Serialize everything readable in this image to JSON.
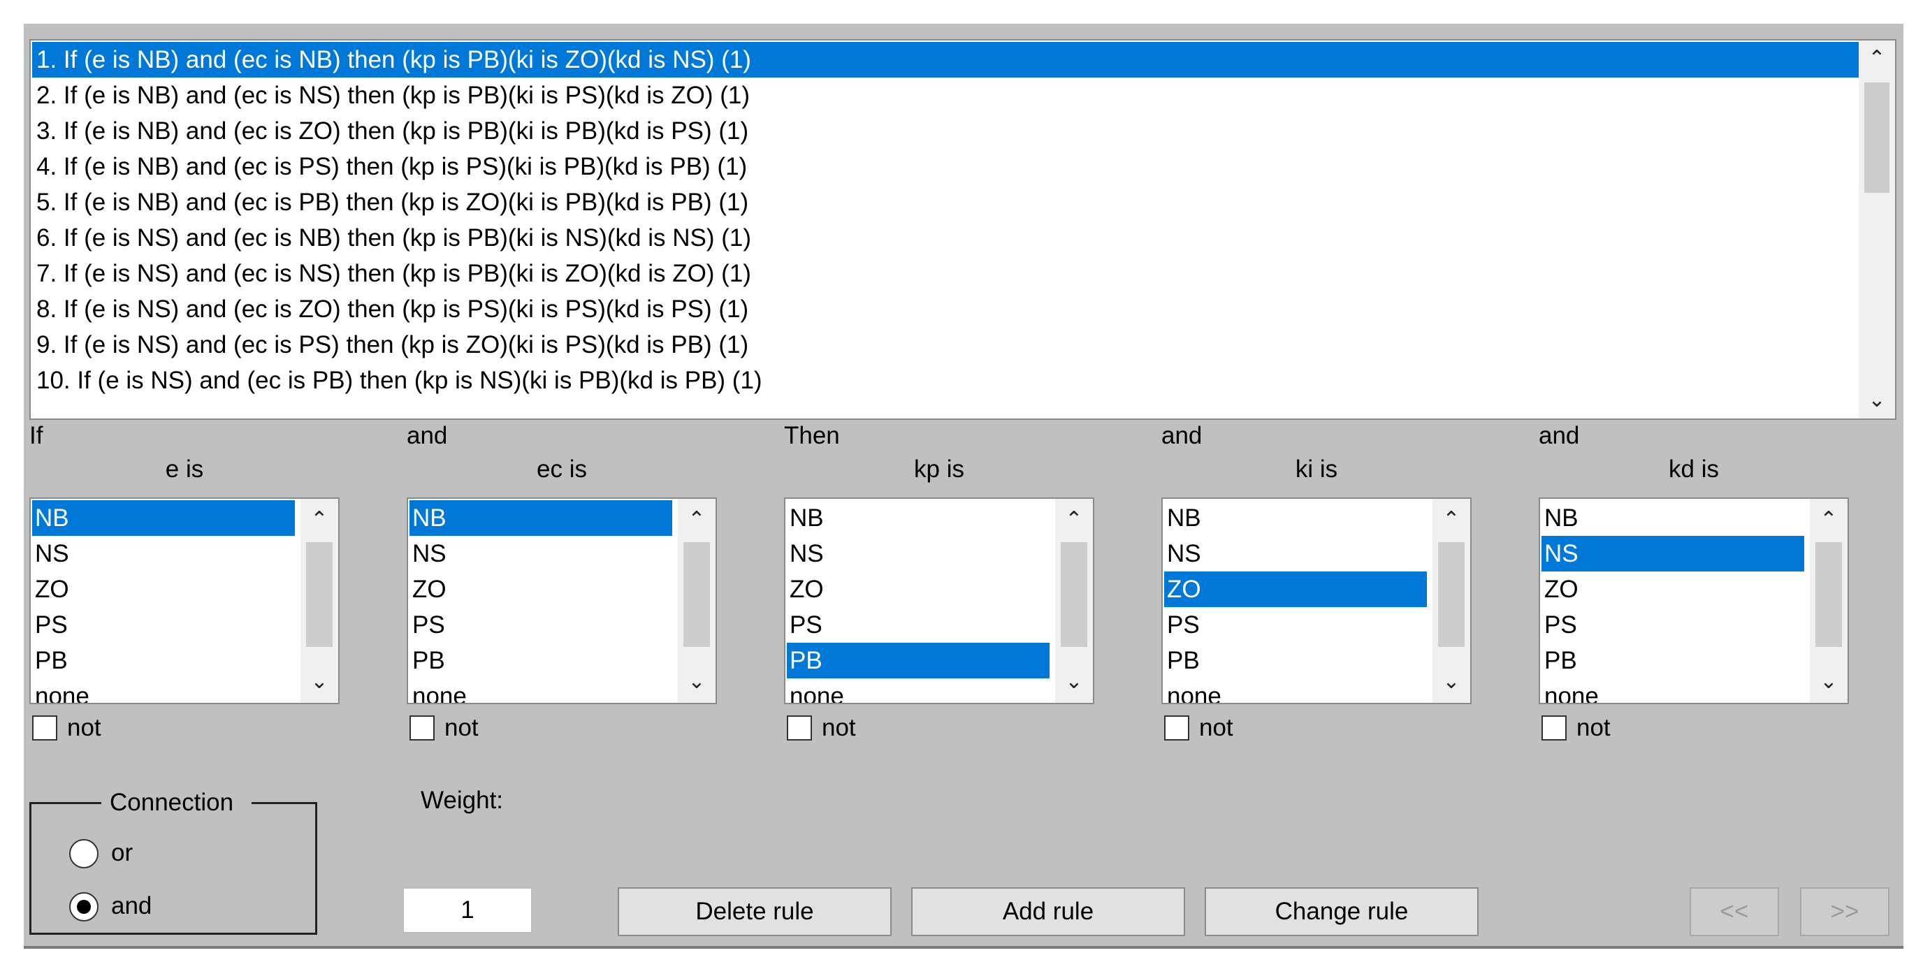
{
  "rules": [
    "1. If (e is NB) and (ec is NB) then (kp is PB)(ki is ZO)(kd is NS) (1)",
    "2. If (e is NB) and (ec is NS) then (kp is PB)(ki is PS)(kd is ZO) (1)",
    "3. If (e is NB) and (ec is ZO) then (kp is PB)(ki is PB)(kd is PS) (1)",
    "4. If (e is NB) and (ec is PS) then (kp is PS)(ki is PB)(kd is PB) (1)",
    "5. If (e is NB) and (ec is PB) then (kp is ZO)(ki is PB)(kd is PB) (1)",
    "6. If (e is NS) and (ec is NB) then (kp is PB)(ki is NS)(kd is NS) (1)",
    "7. If (e is NS) and (ec is NS) then (kp is PB)(ki is ZO)(kd is ZO) (1)",
    "8. If (e is NS) and (ec is ZO) then (kp is PS)(ki is PS)(kd is PS) (1)",
    "9. If (e is NS) and (ec is PS) then (kp is ZO)(ki is PS)(kd is PB) (1)",
    "10. If (e is NS) and (ec is PB) then (kp is NS)(ki is PB)(kd is PB) (1)"
  ],
  "selected_rule_index": 0,
  "icons": {
    "scroll_up": "chevron-up-icon",
    "scroll_down": "chevron-down-icon"
  },
  "colors": {
    "selection": "#0078d7",
    "panel": "#c0c0c0"
  },
  "options": [
    "NB",
    "NS",
    "ZO",
    "PS",
    "PB",
    "none"
  ],
  "columns": [
    {
      "prefix": "If",
      "var_label": "e is",
      "selected": "NB",
      "not_label": "not",
      "not_checked": false
    },
    {
      "prefix": "and",
      "var_label": "ec is",
      "selected": "NB",
      "not_label": "not",
      "not_checked": false
    },
    {
      "prefix": "Then",
      "var_label": "kp is",
      "selected": "PB",
      "not_label": "not",
      "not_checked": false
    },
    {
      "prefix": "and",
      "var_label": "ki is",
      "selected": "ZO",
      "not_label": "not",
      "not_checked": false
    },
    {
      "prefix": "and",
      "var_label": "kd is",
      "selected": "NS",
      "not_label": "not",
      "not_checked": false
    }
  ],
  "connection": {
    "title": "Connection",
    "or_label": "or",
    "and_label": "and",
    "selected": "and"
  },
  "weight": {
    "label": "Weight:",
    "value": "1"
  },
  "buttons": {
    "delete": "Delete rule",
    "add": "Add rule",
    "change": "Change rule",
    "prev": "<<",
    "next": ">>"
  }
}
